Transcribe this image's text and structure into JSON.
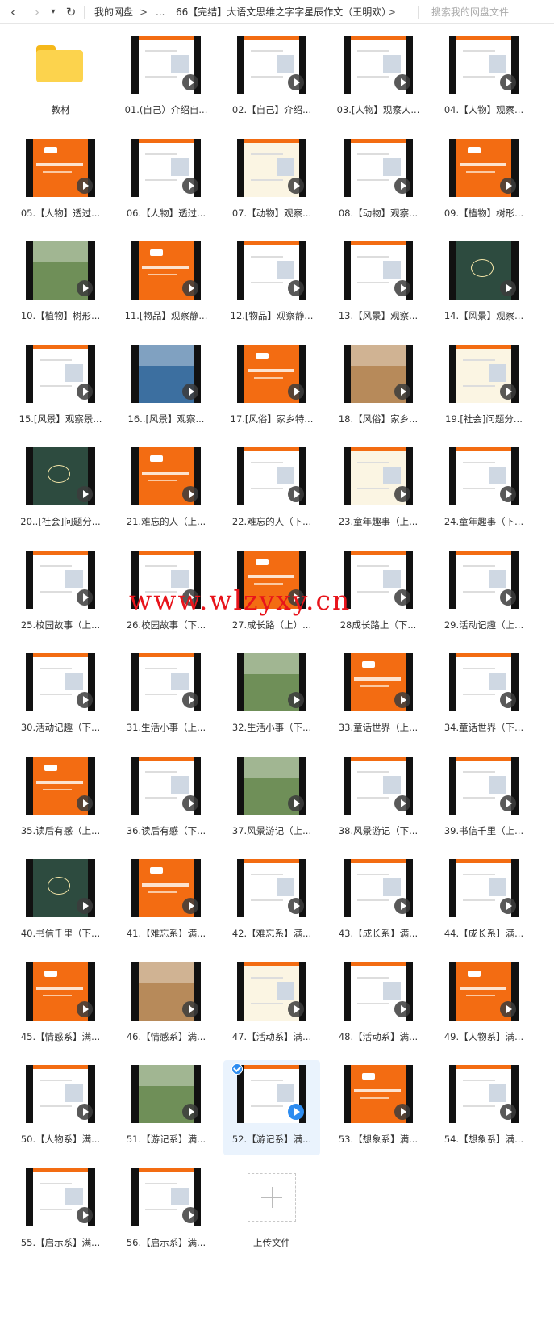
{
  "toolbar": {
    "back_icon": "chevron-left-icon",
    "forward_icon": "chevron-right-icon",
    "history_icon": "caret-down-icon",
    "refresh_icon": "refresh-icon",
    "breadcrumb_root": "我的网盘",
    "breadcrumb_sep": ">",
    "breadcrumb_ellipsis": "...",
    "breadcrumb_current": "66【完结】大语文思维之字字星辰作文（王明欢）",
    "search_placeholder": "搜索我的网盘文件"
  },
  "folder": {
    "label": "教材",
    "icon": "folder-icon"
  },
  "files": [
    {
      "label": "01.(自己）介绍自...",
      "style": "white"
    },
    {
      "label": "02.【自己】介绍...",
      "style": "white"
    },
    {
      "label": "03.[人物】观察人...",
      "style": "white"
    },
    {
      "label": "04.【人物】观察...",
      "style": "white"
    },
    {
      "label": "05.【人物】透过...",
      "style": "orange"
    },
    {
      "label": "06.【人物】透过...",
      "style": "white"
    },
    {
      "label": "07.【动物】观察...",
      "style": "cream"
    },
    {
      "label": "08.【动物】观察...",
      "style": "white"
    },
    {
      "label": "09.【植物】树形...",
      "style": "orange"
    },
    {
      "label": "10.【植物】树形...",
      "style": "photo"
    },
    {
      "label": "11.[物品】观察静...",
      "style": "orange"
    },
    {
      "label": "12.[物品】观察静...",
      "style": "white"
    },
    {
      "label": "13.【风景】观察...",
      "style": "white"
    },
    {
      "label": "14.【风景】观察...",
      "style": "green"
    },
    {
      "label": "15.[风景】观察景...",
      "style": "white"
    },
    {
      "label": "16..[风景】观察...",
      "style": "photo3"
    },
    {
      "label": "17.[风俗】家乡特...",
      "style": "orange"
    },
    {
      "label": "18.【风俗】家乡...",
      "style": "photo2"
    },
    {
      "label": "19.[社会]问题分...",
      "style": "cream"
    },
    {
      "label": "20..[社会]问题分...",
      "style": "green"
    },
    {
      "label": "21.难忘的人（上...",
      "style": "orange"
    },
    {
      "label": "22.难忘的人（下...",
      "style": "white"
    },
    {
      "label": "23.童年趣事（上...",
      "style": "cream"
    },
    {
      "label": "24.童年趣事（下...",
      "style": "white"
    },
    {
      "label": "25.校园故事（上...",
      "style": "white"
    },
    {
      "label": "26.校园故事（下...",
      "style": "white"
    },
    {
      "label": "27.成长路（上）...",
      "style": "orange"
    },
    {
      "label": "28成长路上（下...",
      "style": "white"
    },
    {
      "label": "29.活动记趣（上...",
      "style": "white"
    },
    {
      "label": "30.活动记趣（下...",
      "style": "white"
    },
    {
      "label": "31.生活小事（上...",
      "style": "white"
    },
    {
      "label": "32.生活小事（下...",
      "style": "photo"
    },
    {
      "label": "33.童话世界（上...",
      "style": "orange"
    },
    {
      "label": "34.童话世界（下...",
      "style": "white"
    },
    {
      "label": "35.读后有感（上...",
      "style": "orange"
    },
    {
      "label": "36.读后有感（下...",
      "style": "white"
    },
    {
      "label": "37.风景游记（上...",
      "style": "photo"
    },
    {
      "label": "38.风景游记（下...",
      "style": "white"
    },
    {
      "label": "39.书信千里（上...",
      "style": "white"
    },
    {
      "label": "40.书信千里（下...",
      "style": "green"
    },
    {
      "label": "41.【难忘系】满...",
      "style": "orange"
    },
    {
      "label": "42.【难忘系】满...",
      "style": "white"
    },
    {
      "label": "43.【成长系】满...",
      "style": "white"
    },
    {
      "label": "44.【成长系】满...",
      "style": "white"
    },
    {
      "label": "45.【情感系】满...",
      "style": "orange"
    },
    {
      "label": "46.【情感系】满...",
      "style": "photo2"
    },
    {
      "label": "47.【活动系】满...",
      "style": "cream"
    },
    {
      "label": "48.【活动系】满...",
      "style": "white"
    },
    {
      "label": "49.【人物系】满...",
      "style": "orange"
    },
    {
      "label": "50.【人物系】满...",
      "style": "white"
    },
    {
      "label": "51.【游记系】满...",
      "style": "photo"
    },
    {
      "label": "52.【游记系】满...",
      "style": "white",
      "selected": true
    },
    {
      "label": "53.【想象系】满...",
      "style": "orange"
    },
    {
      "label": "54.【想象系】满...",
      "style": "white"
    },
    {
      "label": "55.【启示系】满...",
      "style": "white"
    },
    {
      "label": "56.【启示系】满...",
      "style": "white"
    }
  ],
  "upload": {
    "label": "上传文件",
    "icon": "plus-icon"
  },
  "watermark": "www.wlzyxy.cn",
  "colors": {
    "accent": "#2d8cf0",
    "slide_orange": "#f36c12",
    "folder": "#fcd34d",
    "watermark": "#e8141b"
  }
}
